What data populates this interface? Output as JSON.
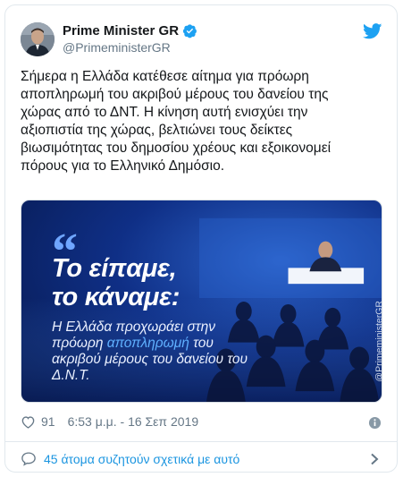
{
  "author": {
    "display_name": "Prime Minister GR",
    "handle": "@PrimeministerGR"
  },
  "tweet": {
    "text": "Σήμερα η Ελλάδα κατέθεσε αίτημα για πρόωρη\nαποπληρωμή του ακριβού μέρους του δανείου της\nχώρας από το ΔΝΤ. Η κίνηση αυτή ενισχύει την\nαξιοπιστία της χώρας, βελτιώνει τους δείκτες\nβιωσιμότητας του δημοσίου χρέους και εξοικονομεί\nπόρους για το Ελληνικό Δημόσιο."
  },
  "media": {
    "quote_mark": "“",
    "headline": "Το είπαμε,\nτο κάναμε:",
    "sub_pre": "Η Ελλάδα προχωράει στην πρόωρη ",
    "sub_accent": "αποπληρωμή",
    "sub_post": " του ακριβού μέρους του δανείου του Δ.Ν.Τ.",
    "watermark": "@PrimeministerGR"
  },
  "meta": {
    "likes": "91",
    "timestamp": "6:53 μ.μ. - 16 Σεπ 2019"
  },
  "conversation": {
    "label": "45 άτομα συζητούν σχετικά με αυτό"
  },
  "colors": {
    "brand_blue": "#1da1f2",
    "link_blue": "#1b95e0",
    "secondary_text": "#657786"
  },
  "icons": [
    "avatar",
    "verified-badge-icon",
    "twitter-bird-icon",
    "heart-icon",
    "info-icon",
    "speech-bubble-icon",
    "chevron-right-icon"
  ]
}
